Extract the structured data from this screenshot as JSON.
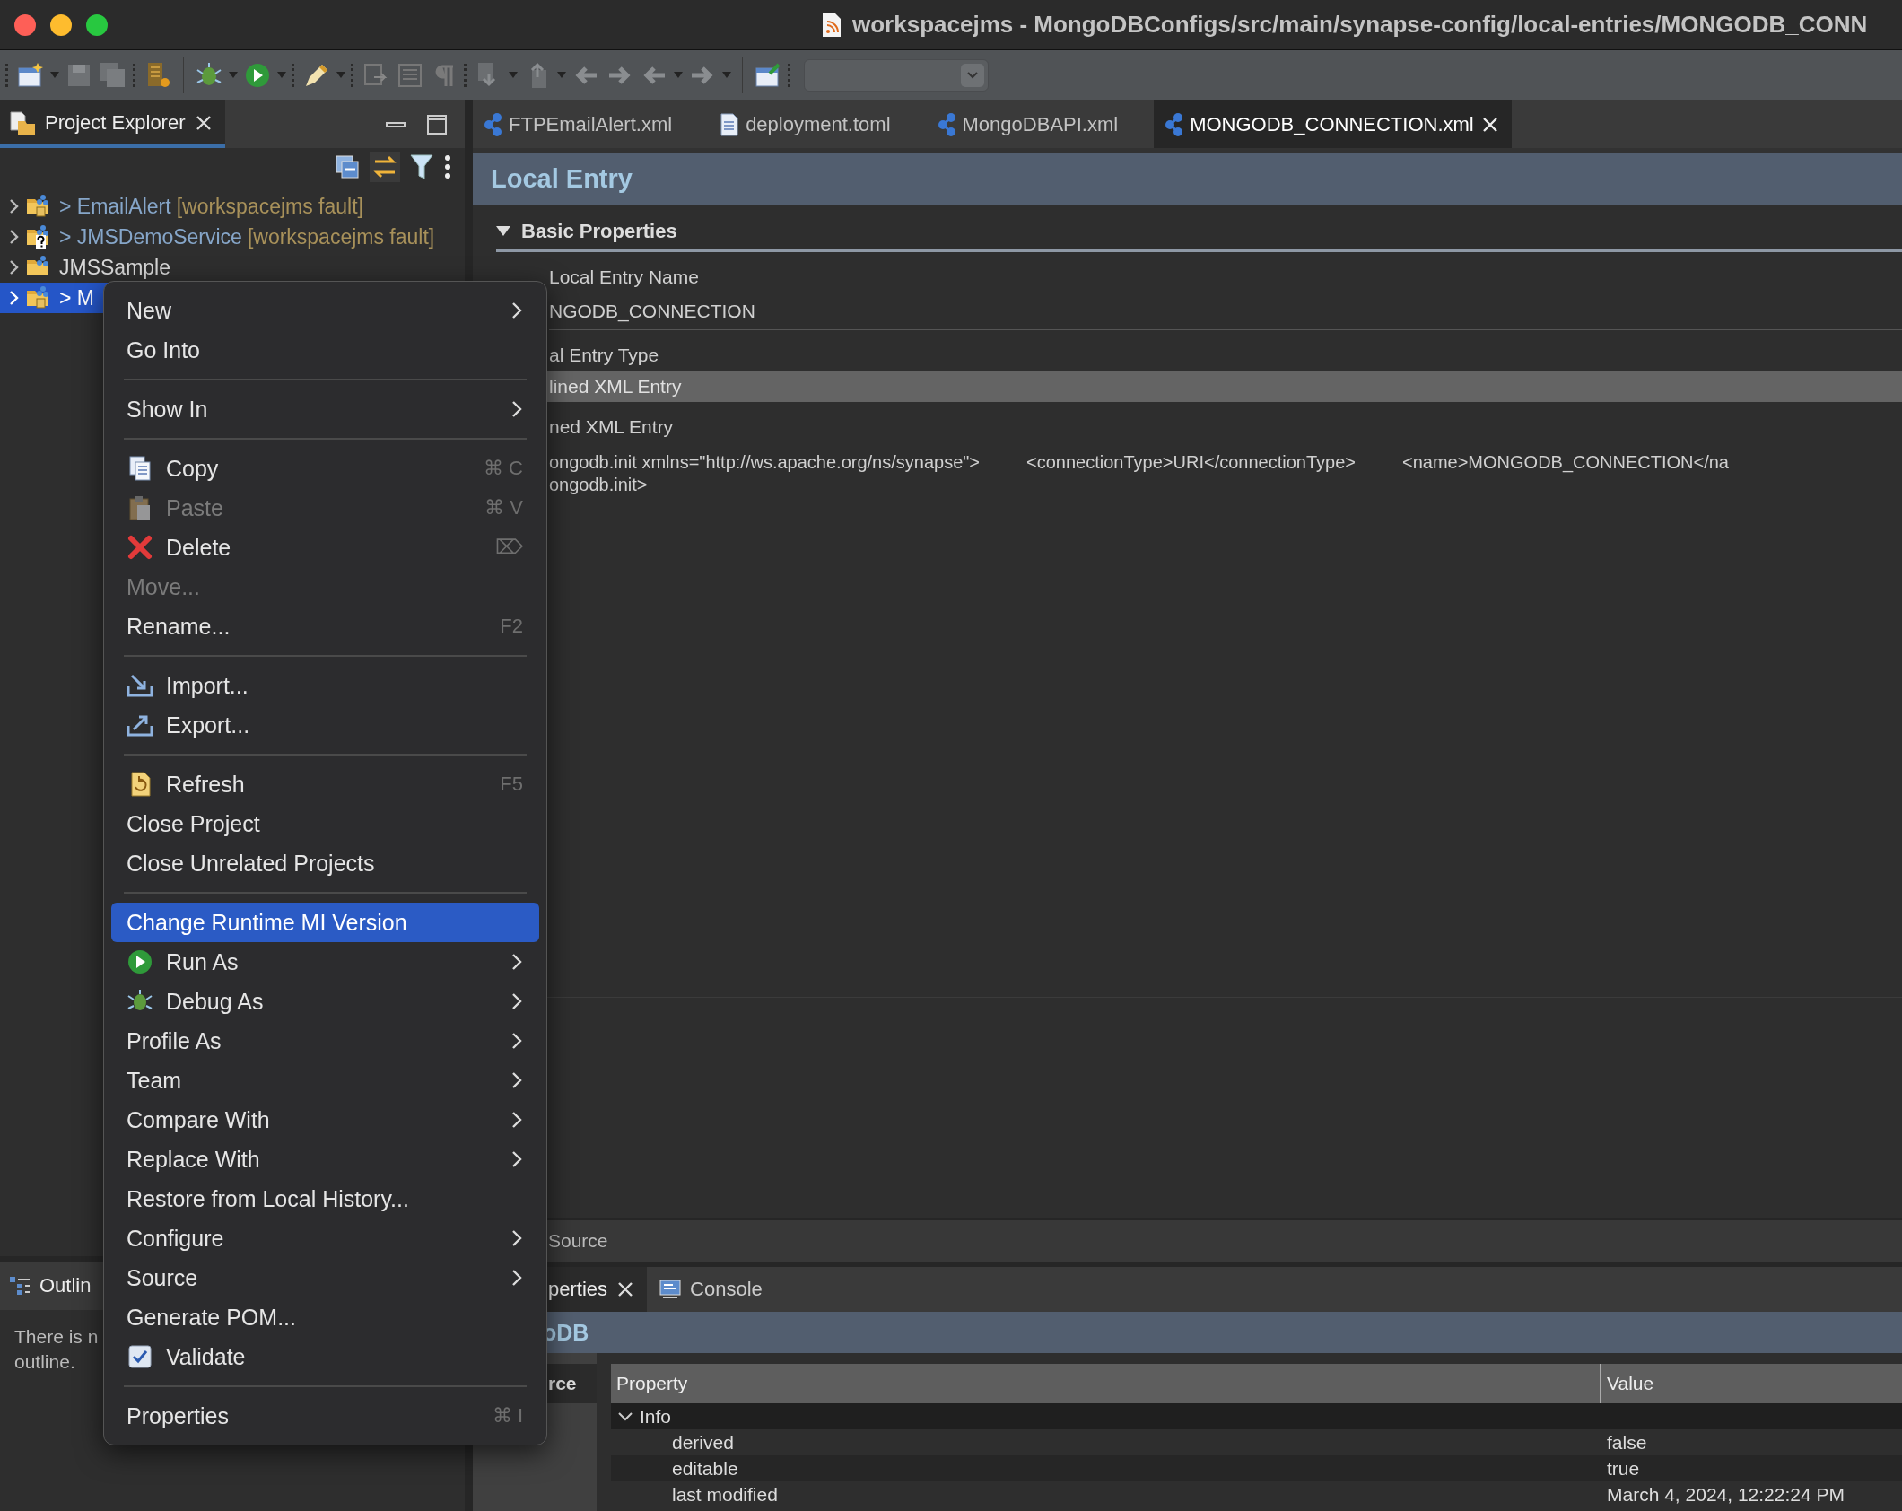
{
  "window": {
    "title": "workspacejms - MongoDBConfigs/src/main/synapse-config/local-entries/MONGODB_CONN"
  },
  "project_explorer": {
    "title": "Project Explorer",
    "items": [
      {
        "kind": "locked",
        "prefix": ">",
        "name": "EmailAlert",
        "decoration": "[workspacejms fault]",
        "selected": false,
        "expanded": false
      },
      {
        "kind": "unknown",
        "prefix": ">",
        "name": "JMSDemoService",
        "decoration": "[workspacejms fault]",
        "selected": false,
        "expanded": false
      },
      {
        "kind": "plain",
        "name": "JMSSample",
        "selected": false,
        "expanded": false
      },
      {
        "kind": "locked",
        "prefix": ">",
        "name": "M",
        "selected": true,
        "expanded": false
      }
    ]
  },
  "outline": {
    "title": "Outlin",
    "message": [
      "There is n",
      "outline."
    ]
  },
  "editor": {
    "tabs": [
      {
        "label": "FTPEmailAlert.xml",
        "kind": "synapse",
        "selected": false
      },
      {
        "label": "deployment.toml",
        "kind": "document",
        "selected": false
      },
      {
        "label": "MongoDBAPI.xml",
        "kind": "synapse",
        "selected": false
      },
      {
        "label": "MONGODB_CONNECTION.xml",
        "kind": "synapse",
        "selected": true
      }
    ],
    "form_title": "Local Entry",
    "section": {
      "title": "Basic Properties",
      "expanded": true
    },
    "fields": [
      {
        "kind": "text",
        "label": "Local Entry Name",
        "value": "NGODB_CONNECTION"
      },
      {
        "kind": "combo",
        "label": "al Entry Type",
        "value": "lined XML Entry"
      },
      {
        "kind": "textarea",
        "label": "ned XML Entry",
        "lines": [
          [
            "ongodb.init xmlns=\"http://ws.apache.org/ns/synapse\">",
            "<connectionType>URI</connectionType>",
            "<name>MONGODB_CONNECTION</na"
          ],
          [
            "ongodb.init>"
          ]
        ]
      }
    ],
    "page_tabs": [
      {
        "label": "Source",
        "selected": false
      }
    ]
  },
  "bottom_panel": {
    "tabs": [
      {
        "label": "perties",
        "kind": "properties",
        "selected": true
      },
      {
        "label": "Console",
        "kind": "console",
        "selected": false
      }
    ],
    "header": "oDB",
    "side_tab": "rce",
    "table": {
      "columns": [
        "Property",
        "Value"
      ],
      "rows": [
        {
          "name": "Info",
          "expanded": true,
          "children": [
            {
              "name": "derived",
              "value": "false"
            },
            {
              "name": "editable",
              "value": "true"
            },
            {
              "name": "last modified",
              "value": "March 4, 2024, 12:22:24 PM"
            }
          ]
        }
      ]
    }
  },
  "context_menu": {
    "items": [
      {
        "kind": "plain",
        "label": "New",
        "submenu": true,
        "disabled": false,
        "selected": false
      },
      {
        "kind": "plain",
        "label": "Go Into",
        "submenu": false,
        "disabled": false,
        "selected": false
      },
      {
        "kind": "separator"
      },
      {
        "kind": "plain",
        "label": "Show In",
        "submenu": true,
        "disabled": false,
        "selected": false
      },
      {
        "kind": "separator"
      },
      {
        "kind": "copy",
        "label": "Copy",
        "shortcut": "⌘ C",
        "submenu": false,
        "disabled": false,
        "selected": false
      },
      {
        "kind": "paste",
        "label": "Paste",
        "shortcut": "⌘ V",
        "submenu": false,
        "disabled": true,
        "selected": false
      },
      {
        "kind": "delete",
        "label": "Delete",
        "shortcut": "⌦",
        "submenu": false,
        "disabled": false,
        "selected": false
      },
      {
        "kind": "plain",
        "label": "Move...",
        "submenu": false,
        "disabled": true,
        "selected": false
      },
      {
        "kind": "plain",
        "label": "Rename...",
        "shortcut": "F2",
        "submenu": false,
        "disabled": false,
        "selected": false
      },
      {
        "kind": "separator"
      },
      {
        "kind": "import",
        "label": "Import...",
        "submenu": false,
        "disabled": false,
        "selected": false
      },
      {
        "kind": "export",
        "label": "Export...",
        "submenu": false,
        "disabled": false,
        "selected": false
      },
      {
        "kind": "separator"
      },
      {
        "kind": "refresh",
        "label": "Refresh",
        "shortcut": "F5",
        "submenu": false,
        "disabled": false,
        "selected": false
      },
      {
        "kind": "plain",
        "label": "Close Project",
        "submenu": false,
        "disabled": false,
        "selected": false
      },
      {
        "kind": "plain",
        "label": "Close Unrelated Projects",
        "submenu": false,
        "disabled": false,
        "selected": false
      },
      {
        "kind": "separator"
      },
      {
        "kind": "plain",
        "label": "Change Runtime MI Version",
        "submenu": false,
        "disabled": false,
        "selected": true
      },
      {
        "kind": "run",
        "label": "Run As",
        "submenu": true,
        "disabled": false,
        "selected": false
      },
      {
        "kind": "debug",
        "label": "Debug As",
        "submenu": true,
        "disabled": false,
        "selected": false
      },
      {
        "kind": "plain",
        "label": "Profile As",
        "submenu": true,
        "disabled": false,
        "selected": false
      },
      {
        "kind": "plain",
        "label": "Team",
        "submenu": true,
        "disabled": false,
        "selected": false
      },
      {
        "kind": "plain",
        "label": "Compare With",
        "submenu": true,
        "disabled": false,
        "selected": false
      },
      {
        "kind": "plain",
        "label": "Replace With",
        "submenu": true,
        "disabled": false,
        "selected": false
      },
      {
        "kind": "plain",
        "label": "Restore from Local History...",
        "submenu": false,
        "disabled": false,
        "selected": false
      },
      {
        "kind": "plain",
        "label": "Configure",
        "submenu": true,
        "disabled": false,
        "selected": false
      },
      {
        "kind": "plain",
        "label": "Source",
        "submenu": true,
        "disabled": false,
        "selected": false
      },
      {
        "kind": "plain",
        "label": "Generate POM...",
        "submenu": false,
        "disabled": false,
        "selected": false
      },
      {
        "kind": "check",
        "label": "Validate",
        "checked": true,
        "submenu": false,
        "disabled": false,
        "selected": false
      },
      {
        "kind": "separator"
      },
      {
        "kind": "plain",
        "label": "Properties",
        "shortcut": "⌘ I",
        "submenu": false,
        "disabled": false,
        "selected": false
      }
    ]
  }
}
